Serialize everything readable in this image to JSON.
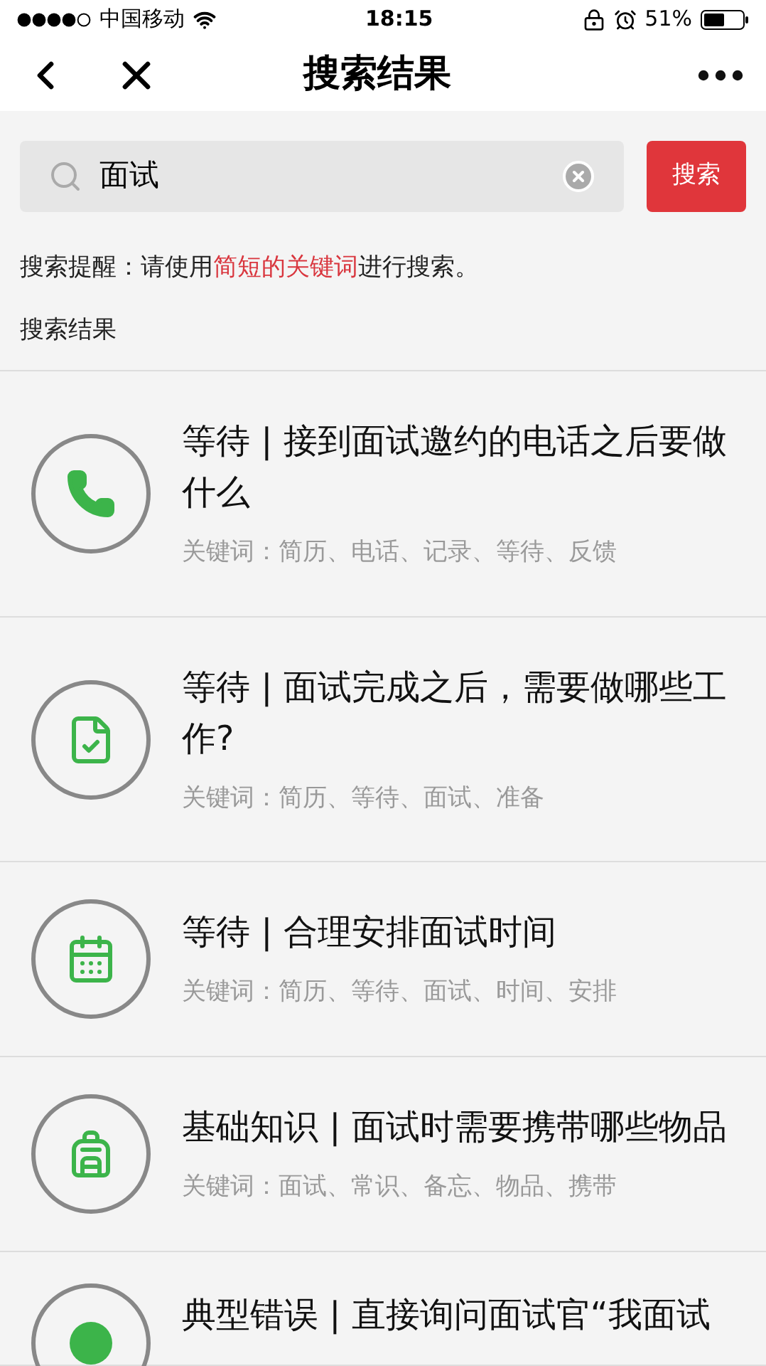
{
  "status_bar": {
    "carrier": "中国移动",
    "time": "18:15",
    "battery": "51%"
  },
  "nav": {
    "title": "搜索结果"
  },
  "search": {
    "value": "面试",
    "button": "搜索"
  },
  "tip": {
    "before": "搜索提醒：请使用",
    "highlight": "简短的关键词",
    "after": "进行搜索。"
  },
  "section_title": "搜索结果",
  "results": [
    {
      "title": "等待 | 接到面试邀约的电话之后要做什么",
      "keywords": "关键词：简历、电话、记录、等待、反馈"
    },
    {
      "title": "等待 | 面试完成之后，需要做哪些工作?",
      "keywords": "关键词：简历、等待、面试、准备"
    },
    {
      "title": "等待 | 合理安排面试时间",
      "keywords": "关键词：简历、等待、面试、时间、安排"
    },
    {
      "title": "基础知识 | 面试时需要携带哪些物品",
      "keywords": "关键词：面试、常识、备忘、物品、携带"
    },
    {
      "title": "典型错误 | 直接询问面试官“我面试"
    }
  ]
}
